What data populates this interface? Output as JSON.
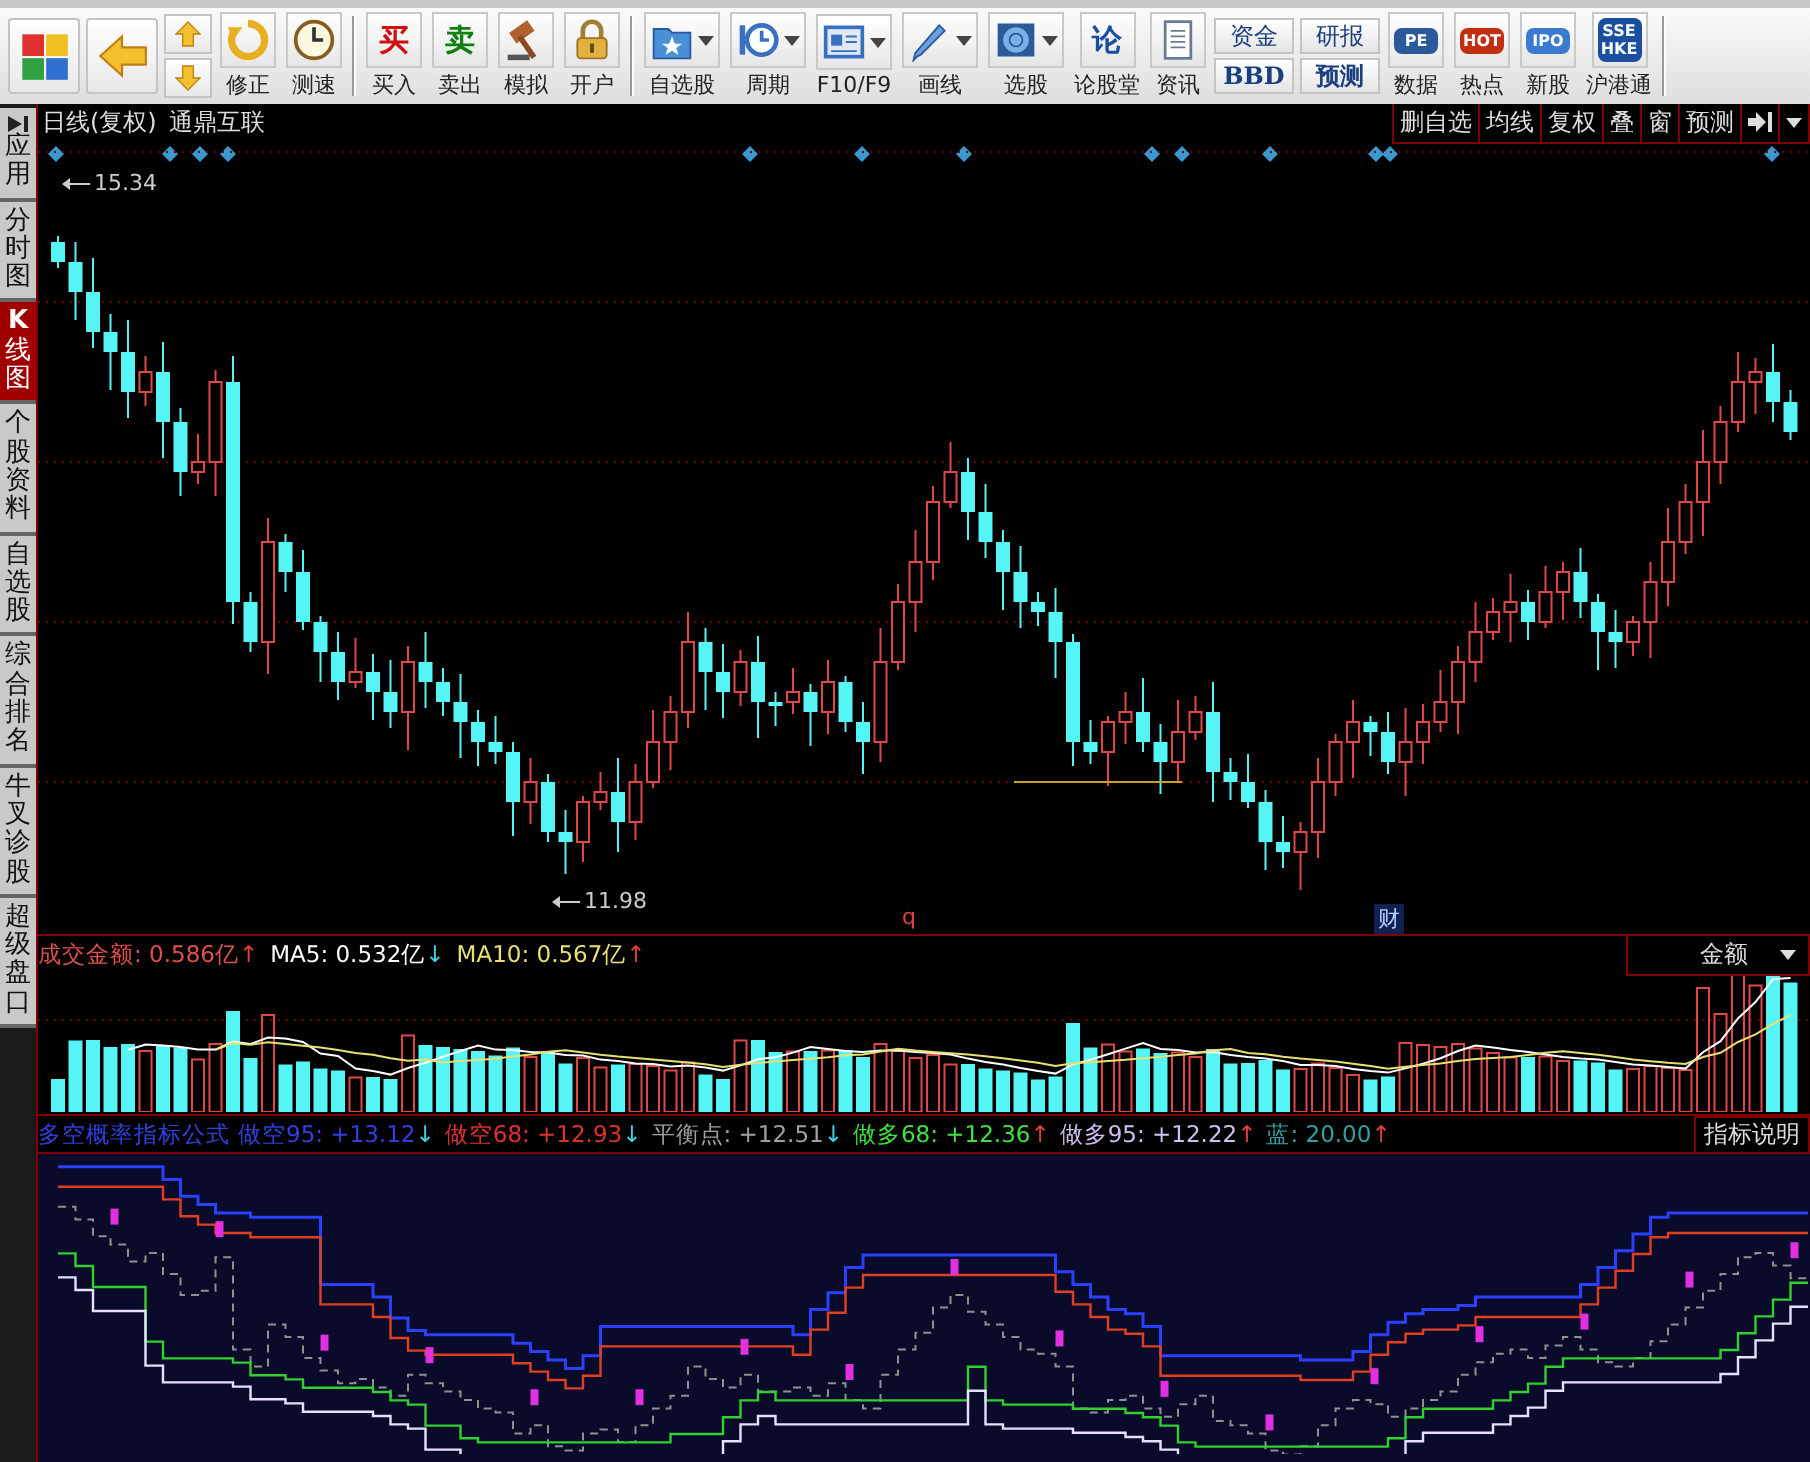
{
  "toolbar": {
    "items": [
      {
        "kind": "big"
      },
      {
        "kind": "big"
      },
      {
        "kind": "arrows"
      },
      {
        "kind": "labeled",
        "label": "修正",
        "menu": false
      },
      {
        "kind": "labeled",
        "label": "测速",
        "menu": false
      },
      {
        "kind": "separator"
      },
      {
        "kind": "labeled",
        "glyph": "买",
        "color": "#d01010",
        "label": "买入",
        "menu": false
      },
      {
        "kind": "labeled",
        "glyph": "卖",
        "color": "#108010",
        "label": "卖出",
        "menu": false
      },
      {
        "kind": "labeled",
        "label": "模拟",
        "menu": false
      },
      {
        "kind": "labeled",
        "label": "开户",
        "menu": false
      },
      {
        "kind": "separator"
      },
      {
        "kind": "labeled",
        "label": "自选股",
        "menu": true
      },
      {
        "kind": "labeled",
        "label": "周期",
        "menu": true
      },
      {
        "kind": "labeled",
        "label": "F10/F9",
        "menu": true
      },
      {
        "kind": "labeled",
        "label": "画线",
        "menu": true
      },
      {
        "kind": "labeled",
        "label": "选股",
        "menu": true
      },
      {
        "kind": "labeled",
        "glyph": "论",
        "color": "#1a4fa0",
        "label": "论股堂",
        "menu": false
      },
      {
        "kind": "labeled",
        "label": "资讯",
        "menu": false
      },
      {
        "kind": "stack",
        "labels": [
          "资金",
          "BBD"
        ]
      },
      {
        "kind": "stack",
        "labels": [
          "研报",
          "预测"
        ]
      },
      {
        "kind": "labeled",
        "glyph": "PE",
        "color": "#2a5a9a",
        "label": "数据",
        "menu": false
      },
      {
        "kind": "labeled",
        "glyph": "HOT",
        "color": "#c03010",
        "label": "热点",
        "menu": false
      },
      {
        "kind": "labeled",
        "glyph": "IPO",
        "color": "#3a7ad0",
        "label": "新股",
        "menu": false
      },
      {
        "kind": "labeled",
        "glyph": "SSE HKE",
        "color": "#1a4fa0",
        "label": "沪港通",
        "menu": false
      },
      {
        "kind": "separator"
      }
    ]
  },
  "sidebar": {
    "tabs": [
      {
        "kind": "app",
        "label": "应用",
        "selected": false
      },
      {
        "kind": "plain",
        "label": "分时图",
        "selected": false
      },
      {
        "kind": "plain",
        "label": "K线图",
        "selected": true
      },
      {
        "kind": "plain",
        "label": "个股资料",
        "selected": false
      },
      {
        "kind": "plain",
        "label": "自选股",
        "selected": false
      },
      {
        "kind": "plain",
        "label": "综合排名",
        "selected": false
      },
      {
        "kind": "plain",
        "label": "牛叉诊股",
        "selected": false
      },
      {
        "kind": "plain",
        "label": "超级盘口",
        "selected": false
      }
    ]
  },
  "chart": {
    "period": "日线(复权)",
    "stock": "通鼎互联",
    "buttons": [
      "删自选",
      "均线",
      "复权",
      "叠",
      "窗",
      "预测"
    ],
    "high_label": "15.34",
    "low_label": "11.98",
    "markers": [
      {
        "kind": "letter",
        "text": "q"
      },
      {
        "kind": "badge",
        "text": "财"
      }
    ]
  },
  "volume": {
    "legend": [
      {
        "kind": "value",
        "text": "成交金额: 0.586亿",
        "color": "#e05050"
      },
      {
        "kind": "arrow",
        "text": "↑",
        "color": "#e04040"
      },
      {
        "kind": "value",
        "text": "MA5: 0.532亿",
        "color": "#ffffff"
      },
      {
        "kind": "arrow",
        "text": "↓",
        "color": "#40d0e0"
      },
      {
        "kind": "value",
        "text": "MA10: 0.567亿",
        "color": "#e8e070"
      },
      {
        "kind": "arrow",
        "text": "↑",
        "color": "#e04040"
      }
    ],
    "selector": "金额"
  },
  "indicator": {
    "title": "多空概率指标公式",
    "legend": [
      {
        "kind": "value",
        "text": "做空95: +13.12",
        "color": "#3040e0"
      },
      {
        "kind": "arrow",
        "text": "↓",
        "color": "#40d0e0"
      },
      {
        "kind": "value",
        "text": "做空68: +12.93",
        "color": "#e03030"
      },
      {
        "kind": "arrow",
        "text": "↓",
        "color": "#40d0e0"
      },
      {
        "kind": "value",
        "text": "平衡点: +12.51",
        "color": "#a0a0a0"
      },
      {
        "kind": "arrow",
        "text": "↓",
        "color": "#40d0e0"
      },
      {
        "kind": "value",
        "text": "做多68: +12.36",
        "color": "#40e040"
      },
      {
        "kind": "arrow",
        "text": "↑",
        "color": "#e04040"
      },
      {
        "kind": "value",
        "text": "做多95: +12.22",
        "color": "#d0c0f0"
      },
      {
        "kind": "arrow",
        "text": "↑",
        "color": "#e04040"
      },
      {
        "kind": "value",
        "text": "蓝: 20.00",
        "color": "#30a0a0"
      },
      {
        "kind": "arrow",
        "text": "↑",
        "color": "#e04040"
      }
    ],
    "help_button": "指标说明"
  }
}
